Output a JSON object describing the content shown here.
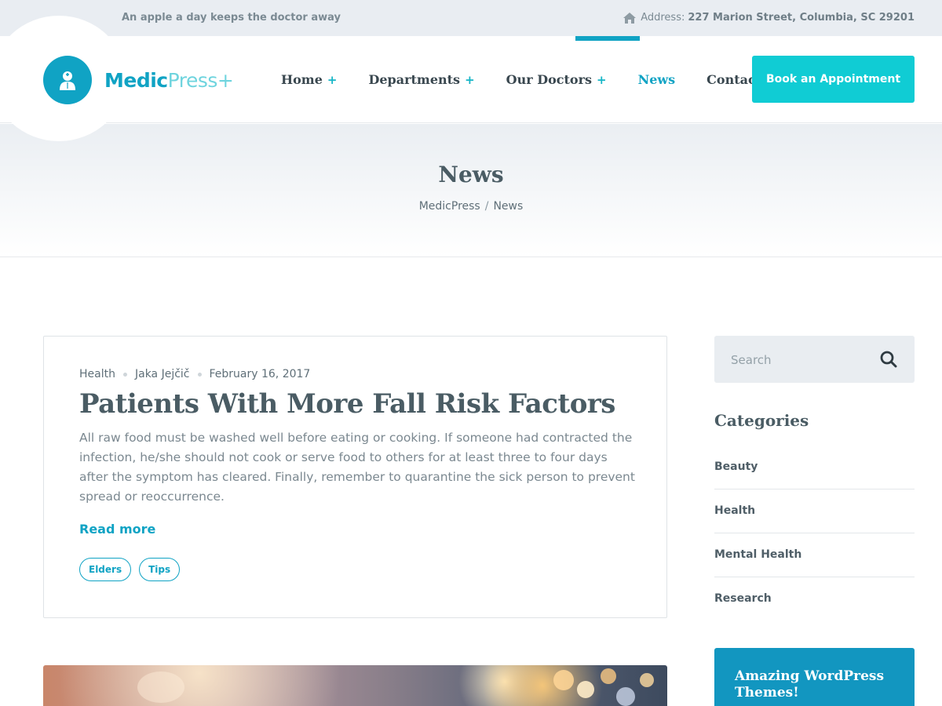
{
  "topbar": {
    "tagline": "An apple a day keeps the doctor away",
    "address_label": "Address:",
    "address_value": "227 Marion Street, Columbia, SC 29201"
  },
  "logo": {
    "brand_main": "Medic",
    "brand_light": "Press+"
  },
  "nav": {
    "items": [
      {
        "label": "Home",
        "plus": "+"
      },
      {
        "label": "Departments",
        "plus": "+"
      },
      {
        "label": "Our Doctors",
        "plus": "+"
      },
      {
        "label": "News"
      },
      {
        "label": "Contact Us"
      }
    ],
    "active": "News",
    "cta": "Book an Appointment"
  },
  "page_title": {
    "title": "News",
    "breadcrumb_home": "MedicPress",
    "breadcrumb_sep": "/",
    "breadcrumb_current": "News"
  },
  "post": {
    "category": "Health",
    "author": "Jaka Jejčič",
    "date": "February 16, 2017",
    "title": "Patients With More Fall Risk Factors",
    "excerpt": "All raw food must be washed well before eating or cooking. If someone had contracted the infection, he/she should not cook or serve food to others for at least three to four days after the symptom has cleared. Finally, remember to quarantine the sick person to prevent spread or reoccurrence.",
    "read_more": "Read more",
    "tags": [
      "Elders",
      "Tips"
    ]
  },
  "sidebar": {
    "search_placeholder": "Search",
    "categories_title": "Categories",
    "categories": [
      "Beauty",
      "Health",
      "Mental Health",
      "Research"
    ],
    "promo_text": "Amazing WordPress Themes!"
  },
  "colors": {
    "accent": "#10a3c4",
    "cta": "#10ccd4",
    "heading": "#4a5c64"
  }
}
